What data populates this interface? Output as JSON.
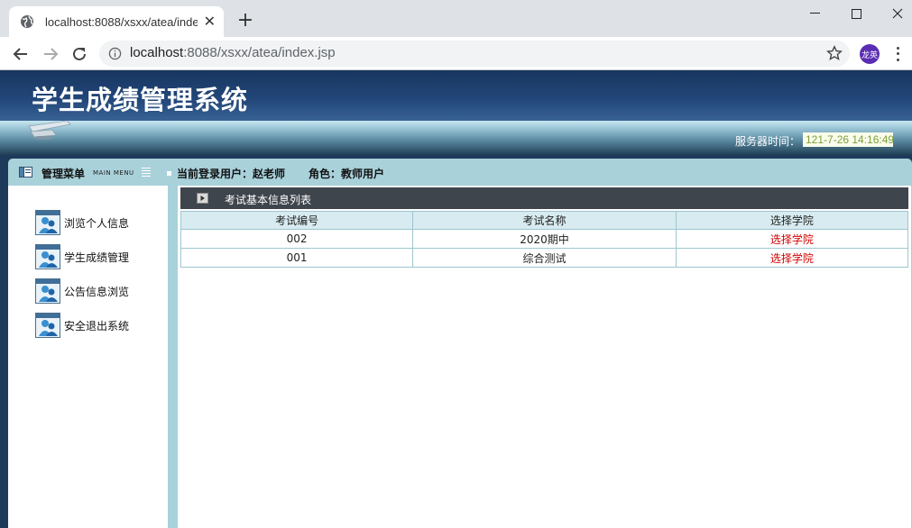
{
  "browser": {
    "tab_title": "localhost:8088/xsxx/atea/index.jsp",
    "url_host": "localhost",
    "url_rest": ":8088/xsxx/atea/index.jsp",
    "avatar_text": "龙英",
    "icons": [
      "globe-icon",
      "close-icon",
      "plus-icon",
      "back-icon",
      "forward-icon",
      "reload-icon",
      "info-icon",
      "star-icon",
      "more-icon",
      "minimize-icon",
      "maximize-icon",
      "window-close-icon"
    ]
  },
  "header": {
    "title": "学生成绩管理系统",
    "server_time_label": "服务器时间：",
    "server_time_value": "121-7-26 14:16:49"
  },
  "menubar": {
    "title": "管理菜单",
    "subtitle": "MAIN MENU",
    "user_label": "当前登录用户：",
    "user_name": "赵老师",
    "role_label": "角色：",
    "role_name": "教师用户"
  },
  "sidebar": {
    "items": [
      {
        "label": "浏览个人信息"
      },
      {
        "label": "学生成绩管理"
      },
      {
        "label": "公告信息浏览"
      },
      {
        "label": "安全退出系统"
      }
    ]
  },
  "content": {
    "title": "考试基本信息列表",
    "columns": [
      "考试编号",
      "考试名称",
      "选择学院"
    ],
    "rows": [
      {
        "id": "002",
        "name": "2020期中",
        "action": "选择学院"
      },
      {
        "id": "001",
        "name": "综合测试",
        "action": "选择学院"
      }
    ]
  },
  "colors": {
    "header_blue": "#23477a",
    "frame_teal": "#a9d1da",
    "content_head": "#3f454d",
    "link_red": "#d40000",
    "time_green": "#7aa038"
  }
}
